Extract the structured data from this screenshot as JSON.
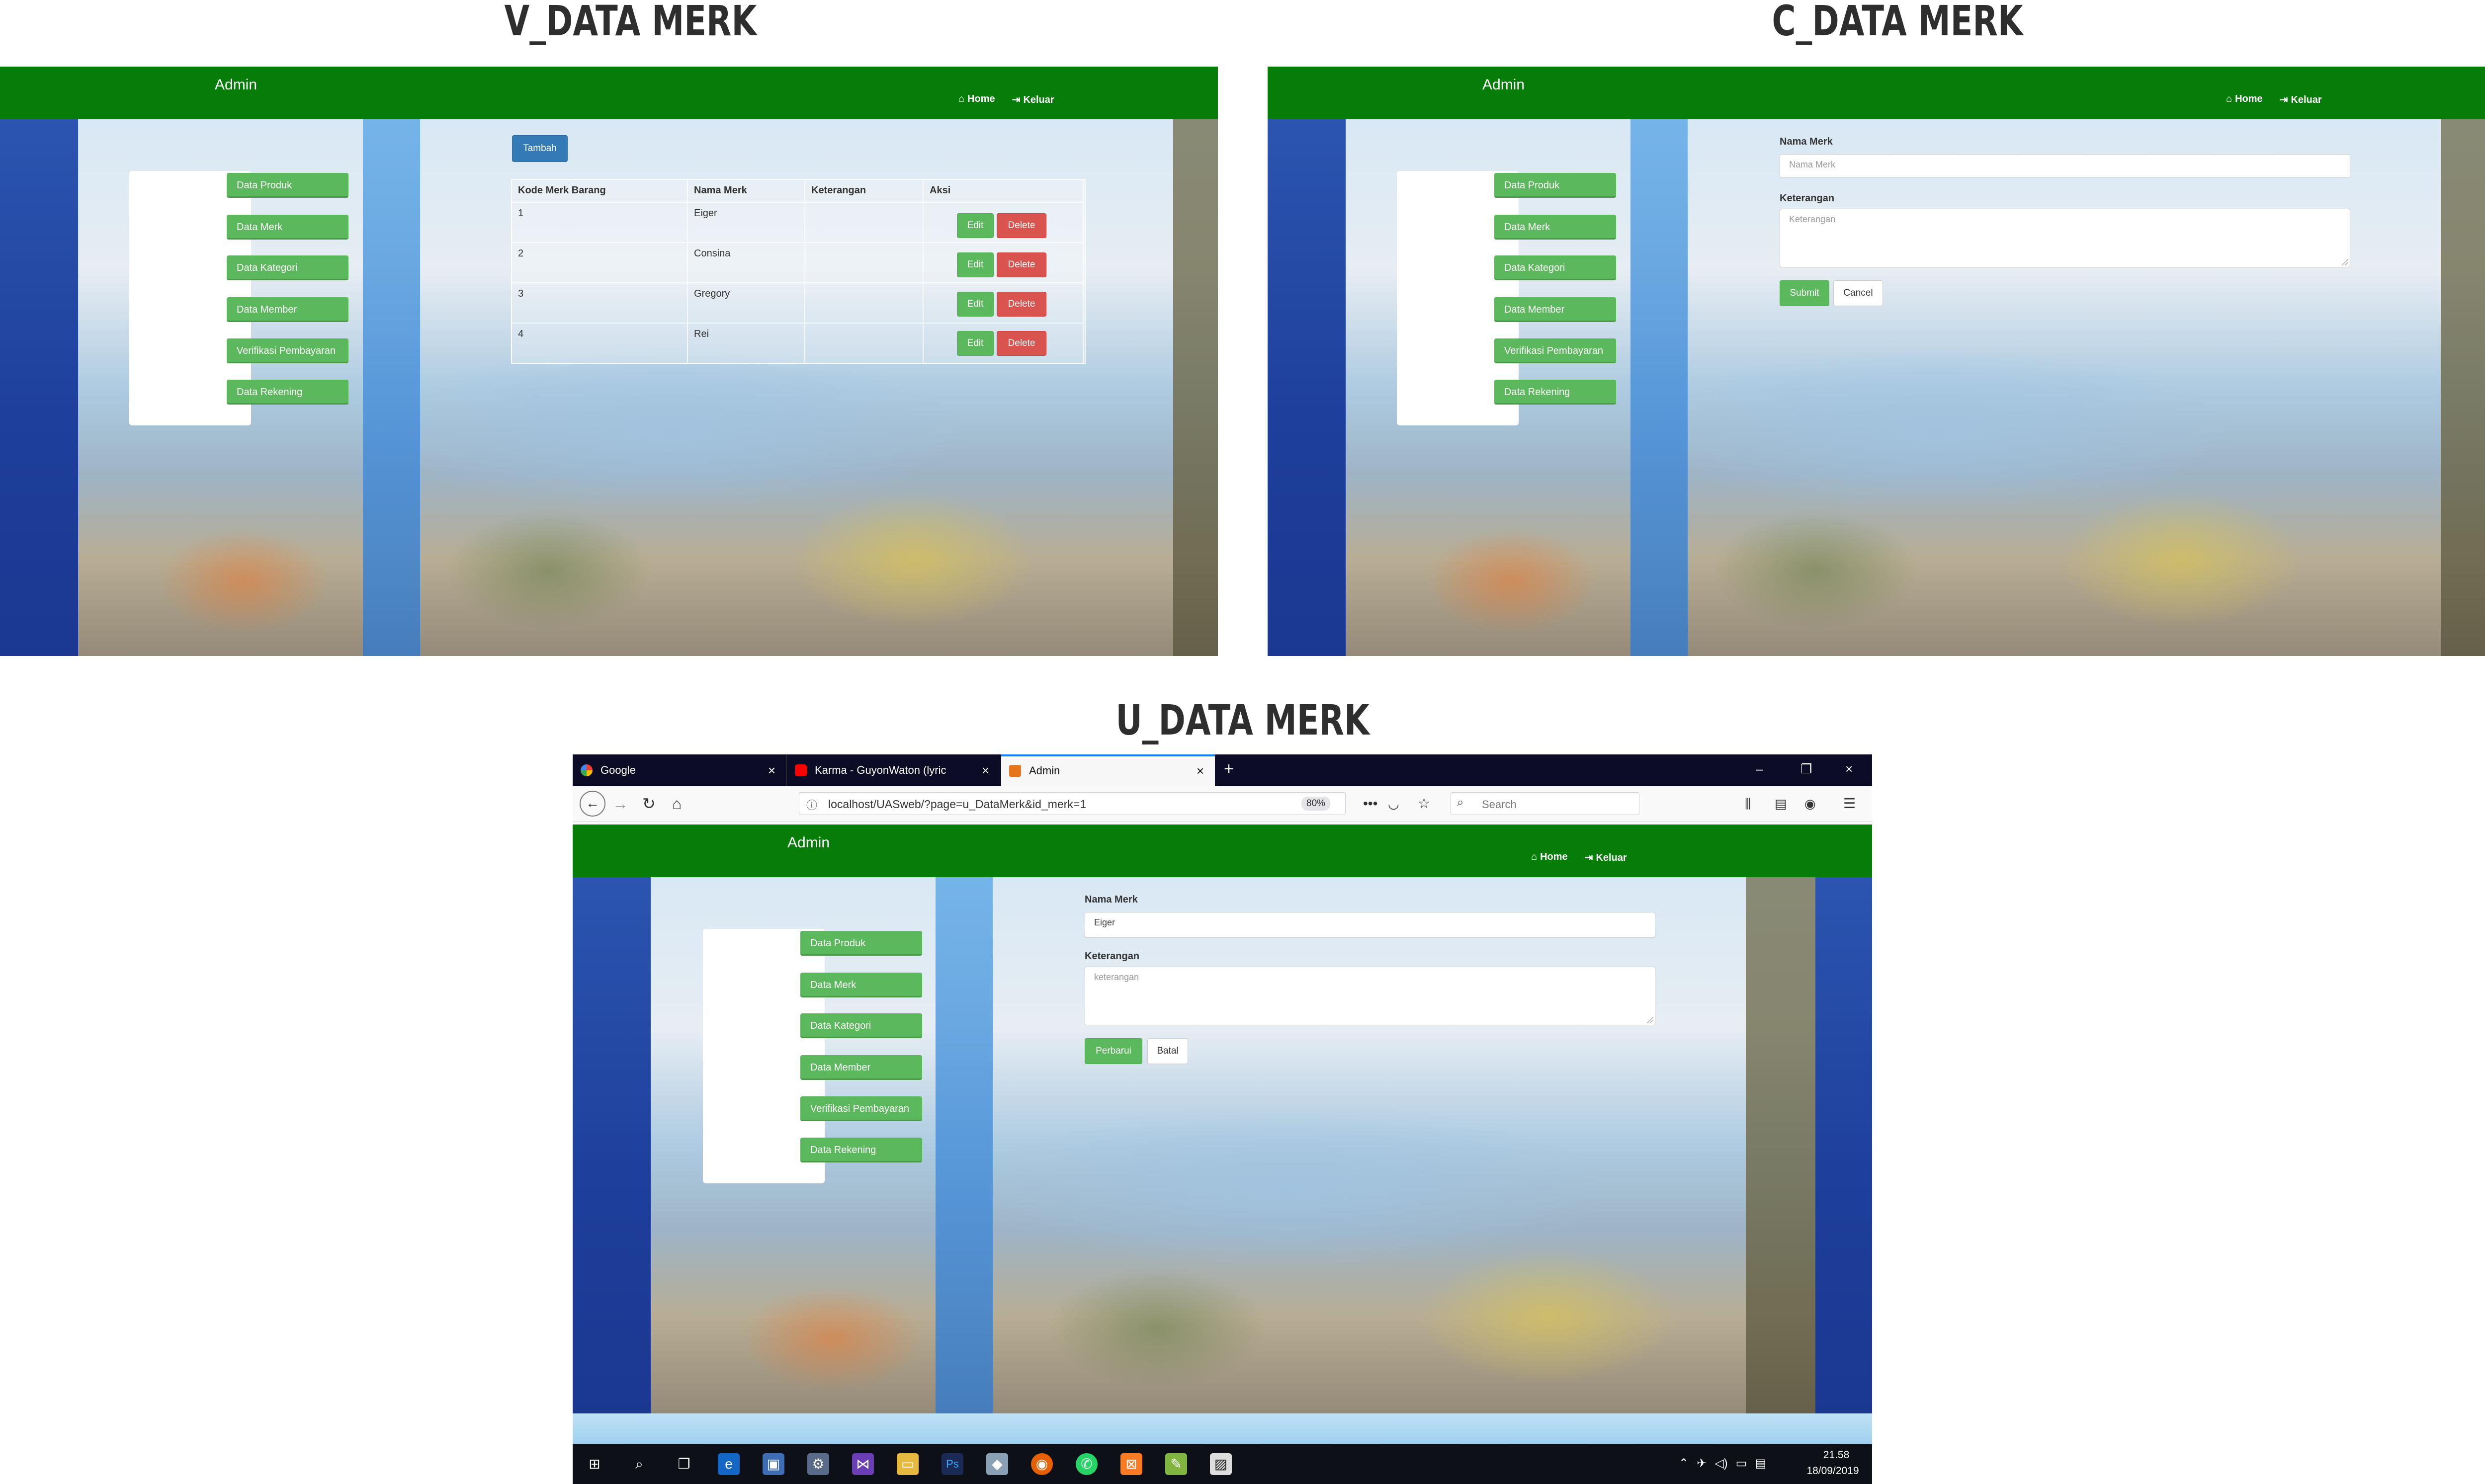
{
  "headings": {
    "v": "V_DATA MERK",
    "c": "C_DATA MERK",
    "u": "U_DATA MERK"
  },
  "colors": {
    "navbar": "#067d08",
    "success": "#5cb85c",
    "danger": "#d9534f",
    "primary": "#337ab7"
  },
  "navbar": {
    "brand": "Admin",
    "home": "Home",
    "keluar": "Keluar",
    "home_icon": "home-icon",
    "keluar_icon": "sign-out-icon"
  },
  "sidebar": {
    "items": [
      {
        "label": "Data Produk"
      },
      {
        "label": "Data Merk"
      },
      {
        "label": "Data Kategori"
      },
      {
        "label": "Data Member"
      },
      {
        "label": "Verifikasi Pembayaran"
      },
      {
        "label": "Data Rekening"
      }
    ]
  },
  "v_page": {
    "add_button": "Tambah",
    "columns": [
      "Kode Merk Barang",
      "Nama Merk",
      "Keterangan",
      "Aksi"
    ],
    "rows": [
      {
        "kode": "1",
        "nama": "Eiger",
        "keterangan": ""
      },
      {
        "kode": "2",
        "nama": "Consina",
        "keterangan": ""
      },
      {
        "kode": "3",
        "nama": "Gregory",
        "keterangan": ""
      },
      {
        "kode": "4",
        "nama": "Rei",
        "keterangan": ""
      }
    ],
    "edit_label": "Edit",
    "delete_label": "Delete"
  },
  "c_page": {
    "nama_label": "Nama Merk",
    "nama_placeholder": "Nama Merk",
    "ket_label": "Keterangan",
    "ket_placeholder": "Keterangan",
    "submit": "Submit",
    "cancel": "Cancel"
  },
  "u_page": {
    "nama_label": "Nama Merk",
    "nama_value": "Eiger",
    "ket_label": "Keterangan",
    "ket_placeholder": "keterangan",
    "submit": "Perbarui",
    "cancel": "Batal"
  },
  "browser": {
    "tabs": [
      {
        "title": "Google",
        "icon": "google-icon"
      },
      {
        "title": "Karma - GuyonWaton (lyric",
        "icon": "youtube-icon"
      },
      {
        "title": "Admin",
        "icon": "page-icon"
      }
    ],
    "url": "localhost/UASweb/?page=u_DataMerk&id_merk=1",
    "zoom": "80%",
    "search_placeholder": "Search"
  },
  "taskbar": {
    "time": "21.58",
    "date": "18/09/2019"
  }
}
